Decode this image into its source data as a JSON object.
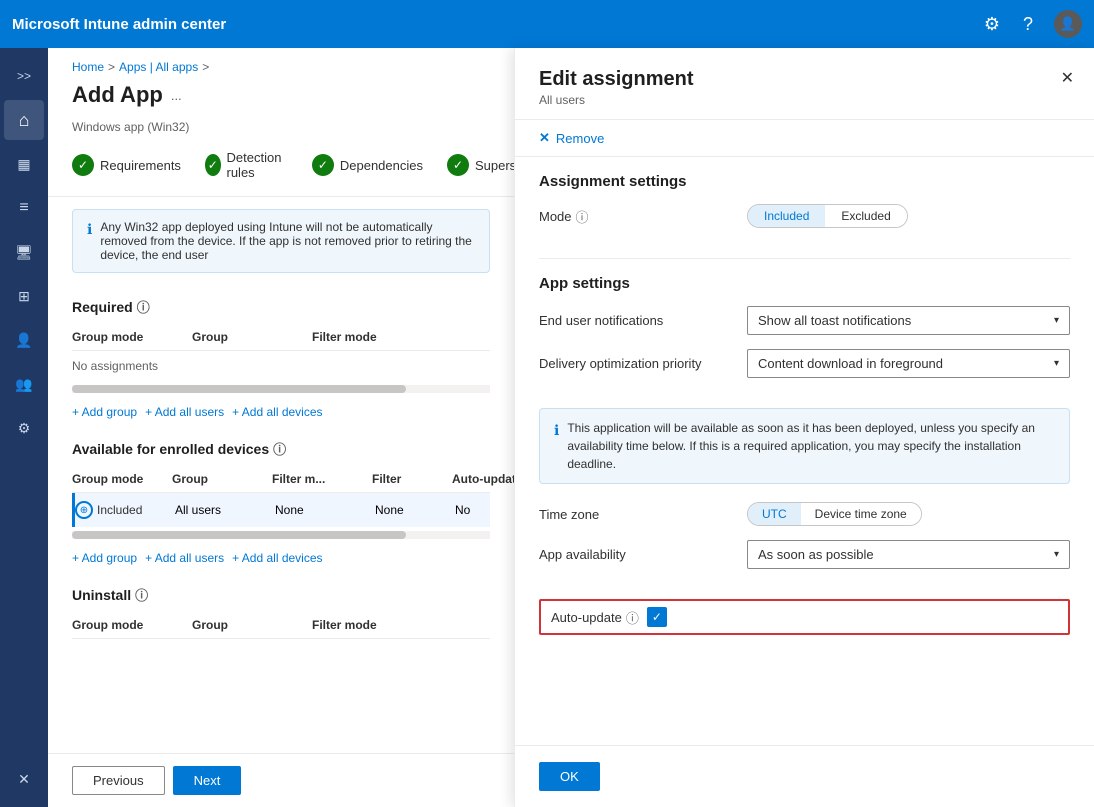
{
  "topbar": {
    "title": "Microsoft Intune admin center",
    "settings_label": "Settings",
    "help_label": "Help",
    "profile_label": "User profile"
  },
  "sidebar": {
    "expand_label": ">>",
    "items": [
      {
        "id": "home",
        "icon": "⌂",
        "label": "Home"
      },
      {
        "id": "dashboard",
        "icon": "▦",
        "label": "Dashboard"
      },
      {
        "id": "reports",
        "icon": "≡",
        "label": "Reports"
      },
      {
        "id": "devices",
        "icon": "□",
        "label": "Devices"
      },
      {
        "id": "apps",
        "icon": "⊞",
        "label": "Apps",
        "active": true
      },
      {
        "id": "users",
        "icon": "👤",
        "label": "Users"
      },
      {
        "id": "groups",
        "icon": "👥",
        "label": "Groups"
      },
      {
        "id": "settings",
        "icon": "⚙",
        "label": "Settings"
      },
      {
        "id": "tools",
        "icon": "✕",
        "label": "Tools"
      }
    ]
  },
  "breadcrumb": {
    "home": "Home",
    "sep1": ">",
    "apps": "Apps | All apps",
    "sep2": ">",
    "current": ""
  },
  "page": {
    "title": "Add App",
    "more_label": "...",
    "subtitle": "Windows app (Win32)"
  },
  "wizard_steps": [
    {
      "label": "Requirements",
      "status": "check"
    },
    {
      "label": "Detection rules",
      "status": "check"
    },
    {
      "label": "Dependencies",
      "status": "check"
    },
    {
      "label": "Supersedence",
      "status": "partial"
    }
  ],
  "info_banner": {
    "text": "Any Win32 app deployed using Intune will not be automatically removed from the device. If the app is not removed prior to retiring the device, the end user"
  },
  "required_section": {
    "title": "Required",
    "columns": [
      "Group mode",
      "Group",
      "Filter mode"
    ],
    "no_assignments": "No assignments",
    "add_group": "+ Add group",
    "add_all_users": "+ Add all users",
    "add_all_devices": "+ Add all devices"
  },
  "available_section": {
    "title": "Available for enrolled devices",
    "columns": [
      "Group mode",
      "Group",
      "Filter m...",
      "Filter",
      "Auto-update"
    ],
    "row": {
      "group_mode": "Included",
      "group": "All users",
      "filter_mode": "None",
      "filter": "None",
      "auto_update": "No"
    },
    "add_group": "+ Add group",
    "add_all_users": "+ Add all users",
    "add_all_devices": "+ Add all devices"
  },
  "uninstall_section": {
    "title": "Uninstall",
    "columns": [
      "Group mode",
      "Group",
      "Filter mode"
    ]
  },
  "footer": {
    "previous": "Previous",
    "next": "Next"
  },
  "panel": {
    "title": "Edit assignment",
    "subtitle": "All users",
    "close_label": "✕",
    "remove_label": "Remove",
    "assignment_settings_title": "Assignment settings",
    "mode_label": "Mode",
    "mode_info": "ⓘ",
    "mode_included": "Included",
    "mode_excluded": "Excluded",
    "app_settings_title": "App settings",
    "end_user_notifications_label": "End user notifications",
    "end_user_notifications_value": "Show all toast notifications",
    "delivery_opt_label": "Delivery optimization priority",
    "delivery_opt_value": "Content download in foreground",
    "info_text": "This application will be available as soon as it has been deployed, unless you specify an availability time below. If this is a required application, you may specify the installation deadline.",
    "time_zone_label": "Time zone",
    "tz_utc": "UTC",
    "tz_device": "Device time zone",
    "app_availability_label": "App availability",
    "app_availability_value": "As soon as possible",
    "auto_update_label": "Auto-update",
    "auto_update_info": "ⓘ",
    "auto_update_checked": true,
    "ok_label": "OK"
  }
}
